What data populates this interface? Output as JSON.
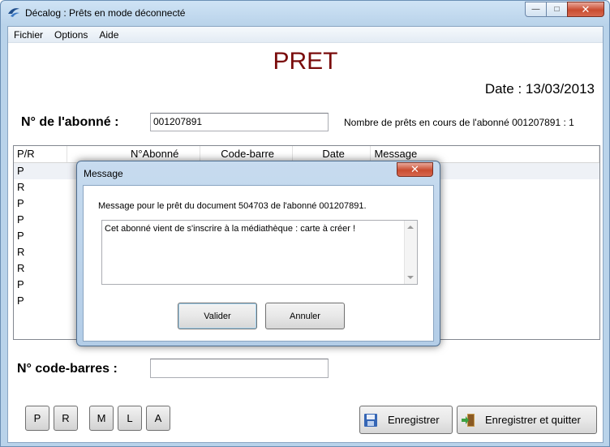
{
  "window": {
    "title": "Décalog : Prêts en mode déconnecté",
    "minimize": "—",
    "maximize": "□",
    "close": "✕"
  },
  "menu": [
    "Fichier",
    "Options",
    "Aide"
  ],
  "form": {
    "heading": "PRET",
    "date": "Date : 13/03/2013",
    "abonne_label": "N° de l'abonné :",
    "abonne_value": "001207891",
    "count_label": "Nombre de prêts en cours de l'abonné 001207891 : 1",
    "code_label": "N° code-barres :",
    "code_value": ""
  },
  "table": {
    "columns": [
      "P/R",
      "N°Abonné",
      "Code-barre",
      "Date",
      "Message"
    ],
    "rows": [
      "P",
      "R",
      "P",
      "P",
      "P",
      "R",
      "R",
      "P",
      "P"
    ]
  },
  "small_buttons": [
    "P",
    "R",
    "M",
    "L",
    "A"
  ],
  "buttons": {
    "save": "Enregistrer",
    "save_quit": "Enregistrer et quitter"
  },
  "dialog": {
    "title": "Message",
    "close": "✕",
    "message": "Message pour le prêt du document 504703 de l'abonné 001207891.",
    "text": "Cet abonné vient de s'inscrire à la médiathèque : carte à créer !",
    "ok": "Valider",
    "cancel": "Annuler"
  }
}
